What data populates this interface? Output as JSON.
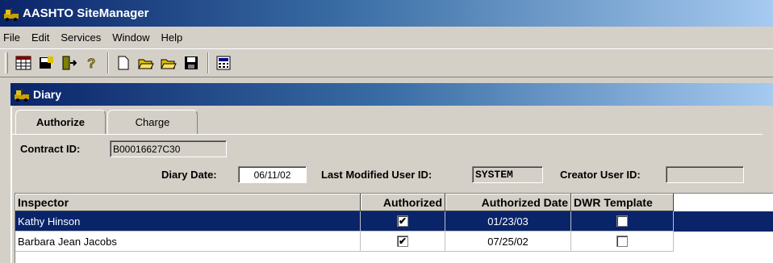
{
  "app": {
    "title": "AASHTO SiteManager"
  },
  "menu": [
    "File",
    "Edit",
    "Services",
    "Window",
    "Help"
  ],
  "toolbar_icons": [
    "calendar-grid-icon",
    "save-disk-icon",
    "exit-door-icon",
    "help-icon",
    "new-document-icon",
    "open-folder-icon",
    "open-folder-2-icon",
    "save-icon",
    "calculator-icon"
  ],
  "window": {
    "title": "Diary"
  },
  "tabs": [
    {
      "label": "Authorize",
      "active": true
    },
    {
      "label": "Charge",
      "active": false
    }
  ],
  "form": {
    "contract_id_label": "Contract ID:",
    "contract_id": "B00016627C30",
    "diary_date_label": "Diary Date:",
    "diary_date": "06/11/02",
    "last_modified_label": "Last Modified User ID:",
    "last_modified": "SYSTEM",
    "creator_label": "Creator User ID:",
    "creator": ""
  },
  "grid": {
    "columns": [
      "Inspector",
      "Authorized",
      "Authorized Date",
      "DWR Template"
    ],
    "rows": [
      {
        "inspector": "Kathy Hinson",
        "authorized": true,
        "authorized_date": "01/23/03",
        "dwr_template": false,
        "selected": true
      },
      {
        "inspector": "Barbara Jean Jacobs",
        "authorized": true,
        "authorized_date": "07/25/02",
        "dwr_template": false,
        "selected": false
      }
    ]
  },
  "colors": {
    "title_dark": "#0a246a",
    "title_light": "#a6caf0",
    "face": "#d4d0c8"
  }
}
